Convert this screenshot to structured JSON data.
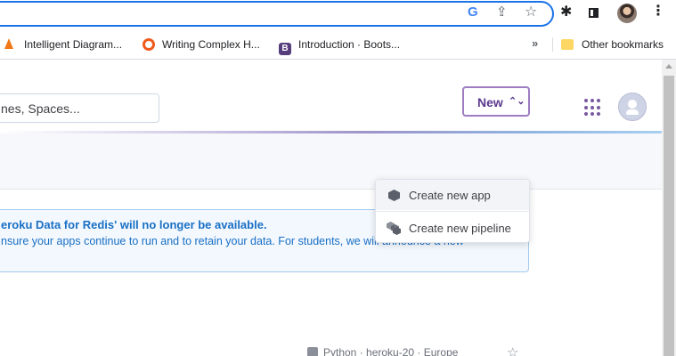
{
  "browser": {
    "toolbar_icons": [
      "google-lens-icon",
      "share-icon",
      "star-icon",
      "extensions-icon",
      "side-panel-icon",
      "profile-avatar",
      "menu-icon"
    ],
    "google_letter": "G",
    "share_glyph": "⇪",
    "star_glyph": "☆",
    "ext_glyph": "✱",
    "menu_glyph": "⋮",
    "bookmarks": [
      {
        "label": "Intelligent Diagram...",
        "icon": "diagram-icon",
        "color": "#f07a1a"
      },
      {
        "label": "Writing Complex H...",
        "icon": "ring-icon",
        "color": "#f05a1e"
      },
      {
        "label": "Introduction · Boots...",
        "icon": "bootstrap-icon",
        "icon_text": "B",
        "color": "#563d7c"
      }
    ],
    "overflow_glyph": "»",
    "other_bookmarks": "Other bookmarks"
  },
  "header": {
    "search_value": "nes, Spaces...",
    "accent": "#79589f"
  },
  "toolbar": {
    "new_label": "New",
    "new_caret": "⌃⌄"
  },
  "dropdown": {
    "items": [
      {
        "label": "Create new app",
        "icon": "app-hexagon-icon"
      },
      {
        "label": "Create new pipeline",
        "icon": "pipeline-icon"
      }
    ]
  },
  "alert": {
    "title": "eroku Data for Redis' will no longer be available.",
    "body": "nsure your apps continue to run and to retain your data. For students, we will announce a new",
    "color": "#1a6fc4"
  },
  "app_row": {
    "meta": "Python · heroku-20 · Europe",
    "star_glyph": "☆"
  }
}
